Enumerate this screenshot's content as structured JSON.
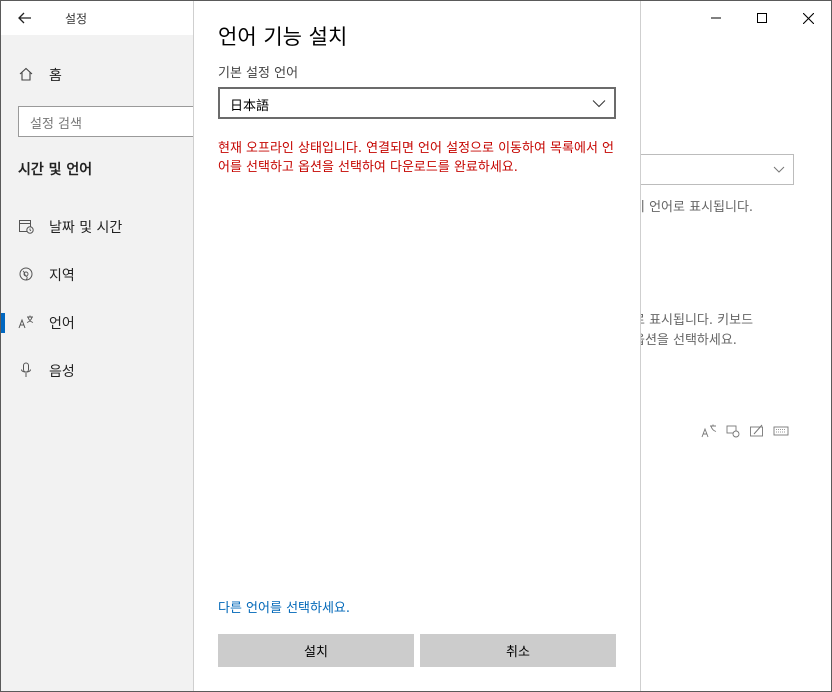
{
  "window": {
    "title": "설정"
  },
  "sidebar": {
    "home_label": "홈",
    "search_placeholder": "설정 검색",
    "section_title": "시간 및 언어",
    "items": [
      {
        "label": "날짜 및 시간",
        "icon": "calendar-clock-icon"
      },
      {
        "label": "지역",
        "icon": "globe-icon"
      },
      {
        "label": "언어",
        "icon": "language-icon",
        "active": true
      },
      {
        "label": "음성",
        "icon": "microphone-icon"
      }
    ]
  },
  "background": {
    "text1": "이 언어로 표시됩니다.",
    "text2": "로 표시됩니다. 키보드",
    "text3": "옵션을 선택하세요."
  },
  "dialog": {
    "title": "언어 기능 설치",
    "lang_label": "기본 설정 언어",
    "selected_language": "日本語",
    "offline_message": "현재 오프라인 상태입니다. 연결되면 언어 설정으로 이동하여 목록에서 언어를 선택하고 옵션을 선택하여 다운로드를 완료하세요.",
    "choose_link": "다른 언어를 선택하세요.",
    "install_button": "설치",
    "cancel_button": "취소"
  },
  "colors": {
    "accent": "#0067c0",
    "error": "#c50500",
    "link": "#0067b8",
    "sidebar_bg": "#f2f2f2",
    "button_bg": "#cccccc"
  }
}
